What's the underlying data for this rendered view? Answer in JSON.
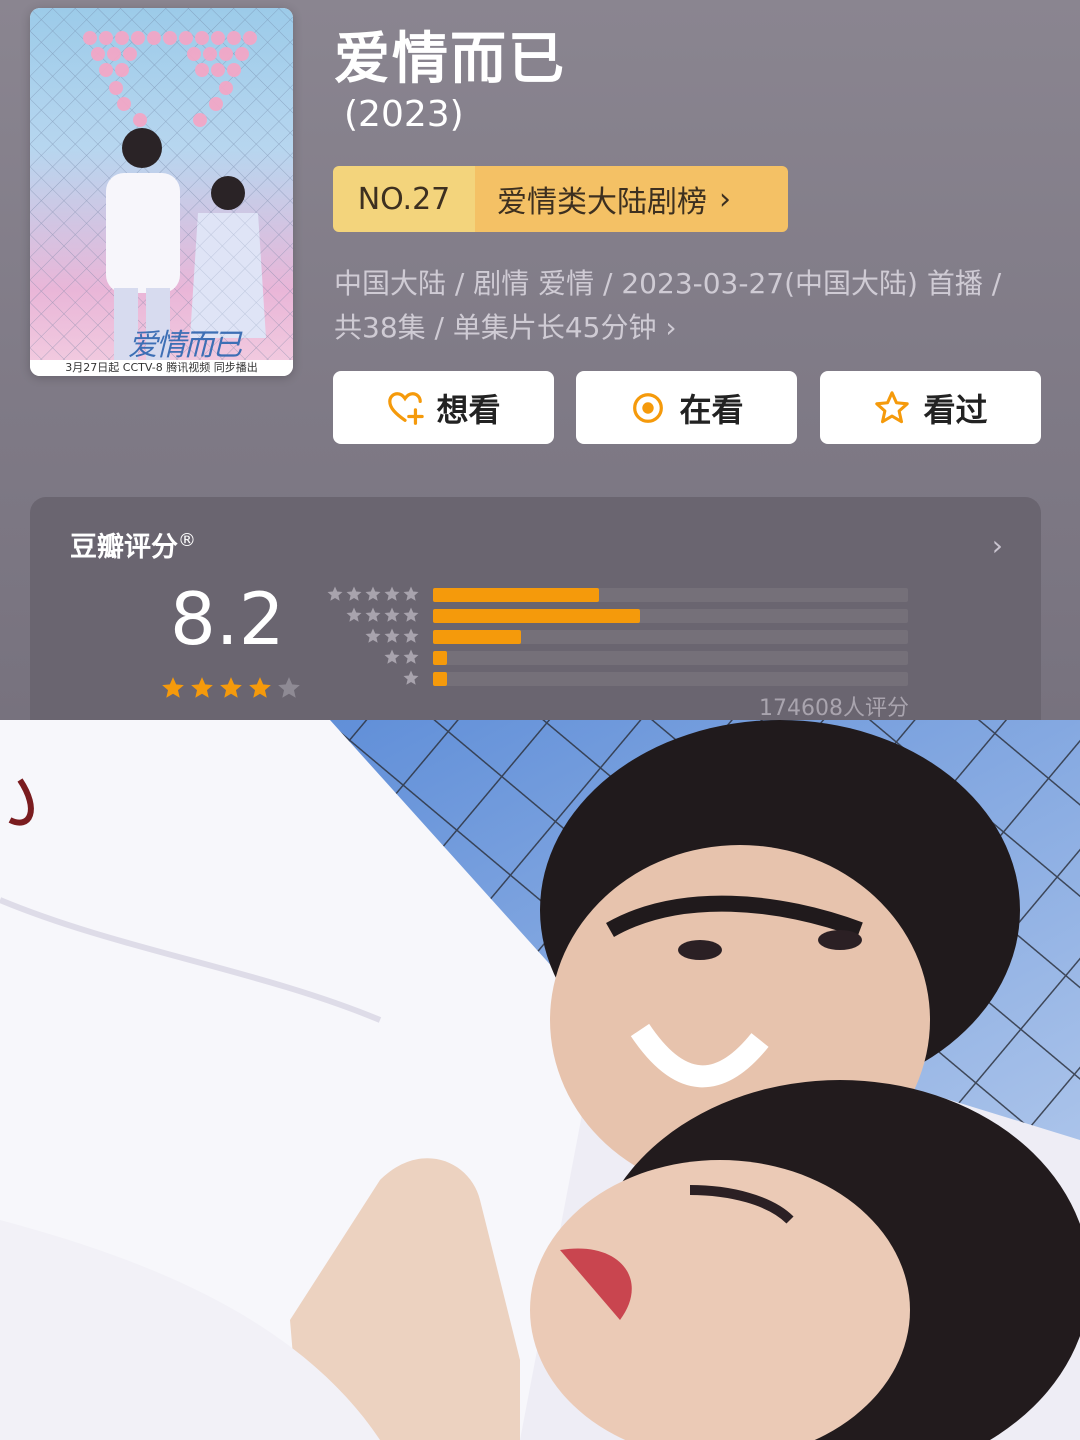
{
  "poster": {
    "logo_text": "爱情而已",
    "footer_text": "3月27日起 CCTV-8 腾讯视频 同步播出"
  },
  "show": {
    "title": "爱情而已",
    "year": "(2023)"
  },
  "ranking": {
    "number": "NO.27",
    "list_name": "爱情类大陆剧榜",
    "chevron": "›"
  },
  "meta": {
    "line1": "中国大陆 / 剧情 爱情 / 2023-03-27(中国大陆) 首播 /",
    "line2": "共38集 / 单集片长45分钟 ›"
  },
  "actions": [
    {
      "label": "想看",
      "icon": "heart-plus-icon"
    },
    {
      "label": "在看",
      "icon": "target-dot-icon"
    },
    {
      "label": "看过",
      "icon": "star-outline-icon"
    }
  ],
  "rating": {
    "title": "豆瓣评分",
    "title_mark": "®",
    "arrow": "›",
    "score": "8.2",
    "stars_filled": 4,
    "stars_total": 5,
    "distribution": [
      {
        "stars": 5,
        "fraction": 0.35
      },
      {
        "stars": 4,
        "fraction": 0.435
      },
      {
        "stars": 3,
        "fraction": 0.185
      },
      {
        "stars": 2,
        "fraction": 0.03
      },
      {
        "stars": 1,
        "fraction": 0.03
      }
    ],
    "count_text": "174608人评分"
  },
  "colors": {
    "accent_orange": "#f59a0b",
    "rank_light": "#f3d47c",
    "rank_dark": "#f4c165",
    "card_bg": "#6a6570"
  }
}
